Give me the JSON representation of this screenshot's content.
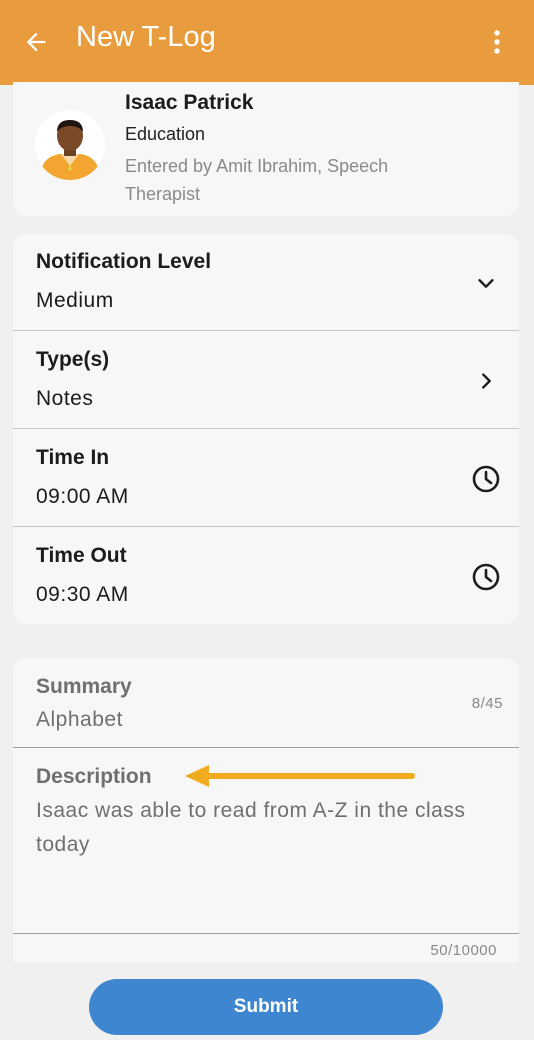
{
  "appbar": {
    "title": "New T-Log",
    "back_icon": "arrow-left-icon",
    "menu_icon": "more-vertical-icon",
    "color": "#e89c3e"
  },
  "profile": {
    "name": "Isaac Patrick",
    "department": "Education",
    "entered_by": "Entered by Amit Ibrahim, Speech Therapist"
  },
  "details": {
    "notification_level": {
      "label": "Notification Level",
      "value": "Medium",
      "icon": "chevron-down-icon"
    },
    "types": {
      "label": "Type(s)",
      "value": "Notes",
      "icon": "chevron-right-icon"
    },
    "time_in": {
      "label": "Time In",
      "value": "09:00 AM",
      "icon": "clock-icon"
    },
    "time_out": {
      "label": "Time Out",
      "value": "09:30 AM",
      "icon": "clock-icon"
    }
  },
  "summary": {
    "label": "Summary",
    "value": "Alphabet",
    "counter": "8/45"
  },
  "description": {
    "label": "Description",
    "value": "Isaac was able to read from A-Z in the class today",
    "counter": "50/10000",
    "annotation_arrow_color": "#f0ac1e"
  },
  "submit": {
    "label": "Submit",
    "color": "#3f86d1"
  }
}
